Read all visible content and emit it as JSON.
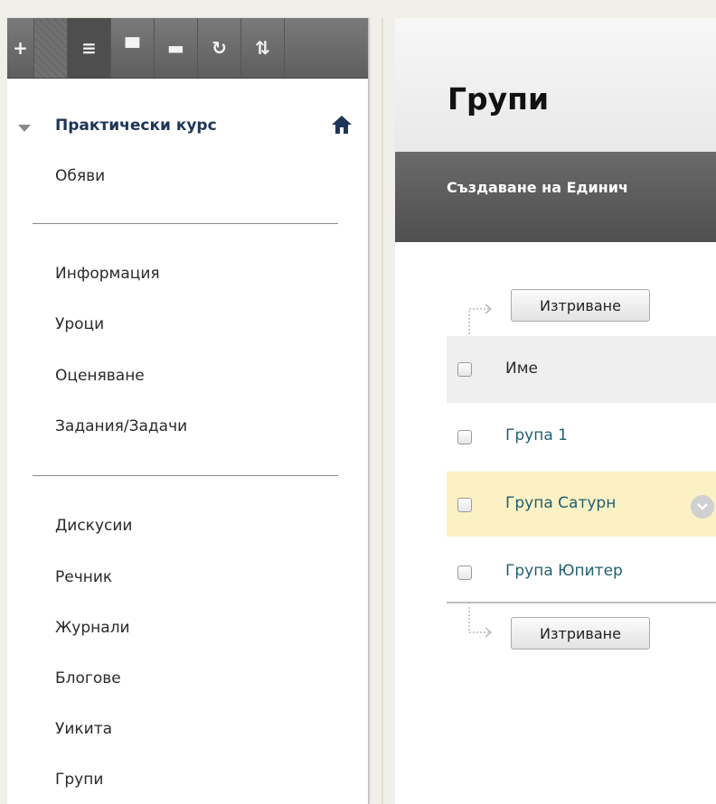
{
  "sidebar": {
    "toolbar_icons": [
      "plus-icon",
      "grip-icon",
      "list-icon",
      "folder-icon",
      "window-icon",
      "refresh-icon",
      "sort-icon"
    ],
    "toolbar_glyphs": [
      "+",
      "",
      "≡",
      "▀",
      "▬",
      "↻",
      "⇅"
    ],
    "course_title": "Практически курс",
    "items_group1": [
      "Обяви"
    ],
    "items_group2": [
      "Информация",
      "Уроци",
      "Оценяване",
      "Задания/Задачи"
    ],
    "items_group3": [
      "Дискусии",
      "Речник",
      "Журнали",
      "Блогове",
      "Уикита",
      "Групи"
    ]
  },
  "page": {
    "title": "Групи",
    "action_create": "Създаване на Единич"
  },
  "table": {
    "delete_label": "Изтриване",
    "header_name": "Име",
    "rows": [
      "Група 1",
      "Група Сатурн",
      "Група Юпитер"
    ]
  },
  "colors": {
    "accent_link": "#1f5f6f",
    "highlight_row": "#fbf1c4",
    "course_title": "#1d3557"
  }
}
